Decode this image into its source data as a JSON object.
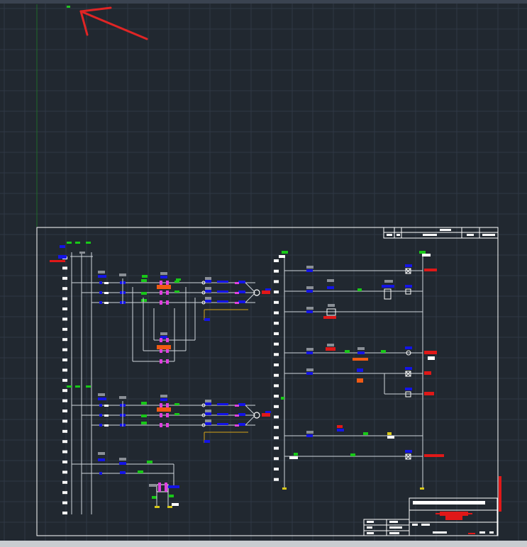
{
  "app": {
    "view": "cad-model-space",
    "background_color": "#212830",
    "grid_color": "#2f3845"
  },
  "annotations": {
    "arrow_color": "#e02525",
    "marker_color": "#22c022"
  },
  "drawing": {
    "border_color": "#ffffff",
    "wire_color": "#cfd6dc",
    "symbol_colors": {
      "blue": "#1414e6",
      "green": "#18c818",
      "magenta": "#e040e0",
      "gray": "#8a8f96",
      "red": "#e01818",
      "orange": "#f05a14",
      "yellow": "#d8c818",
      "white": "#ffffff"
    }
  }
}
